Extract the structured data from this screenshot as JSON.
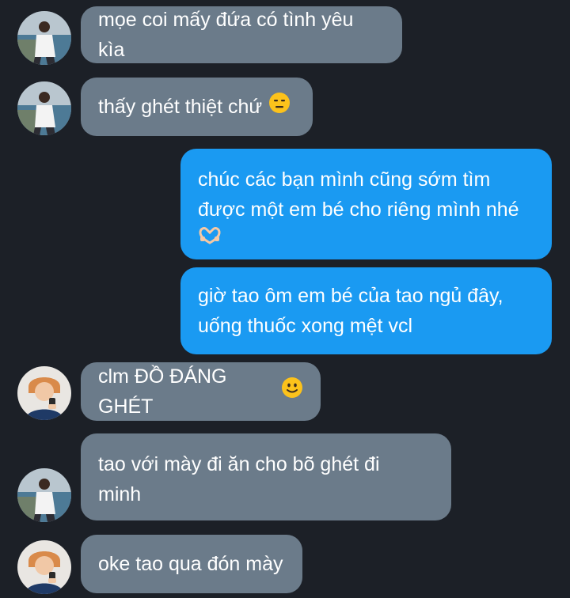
{
  "messages": [
    {
      "side": "in",
      "avatar": "avatar-boy-white-shirt",
      "text": "mọe coi mấy đứa có tình yêu kìa"
    },
    {
      "side": "in",
      "avatar": "avatar-boy-white-shirt",
      "text": "thấy ghét thiệt chứ",
      "emoji": "expressionless-face-emoji"
    },
    {
      "side": "out",
      "text_line1": "chúc các bạn mình cũng sớm tìm",
      "text_line2": "được một em bé cho riêng mình nhé",
      "emoji": "heart-hands-emoji"
    },
    {
      "side": "out",
      "text_line1": "giờ tao ôm em bé của tao ngủ đây,",
      "text_line2": "uống thuốc xong mệt vcl"
    },
    {
      "side": "in",
      "avatar": "avatar-boy-orange-hair",
      "text": "clm ĐỒ ĐÁNG GHÉT",
      "emoji": "slightly-smiling-face-emoji"
    },
    {
      "side": "in",
      "avatar": "avatar-boy-white-shirt",
      "text_line1": "tao với mày đi ăn cho bõ ghét đi",
      "text_line2": "minh"
    },
    {
      "side": "in",
      "avatar": "avatar-boy-orange-hair",
      "text": "oke tao qua đón mày"
    }
  ],
  "colors": {
    "background": "#1c2027",
    "incoming_bubble": "#6b7b8a",
    "outgoing_bubble": "#1a9af2",
    "text": "#ffffff"
  }
}
